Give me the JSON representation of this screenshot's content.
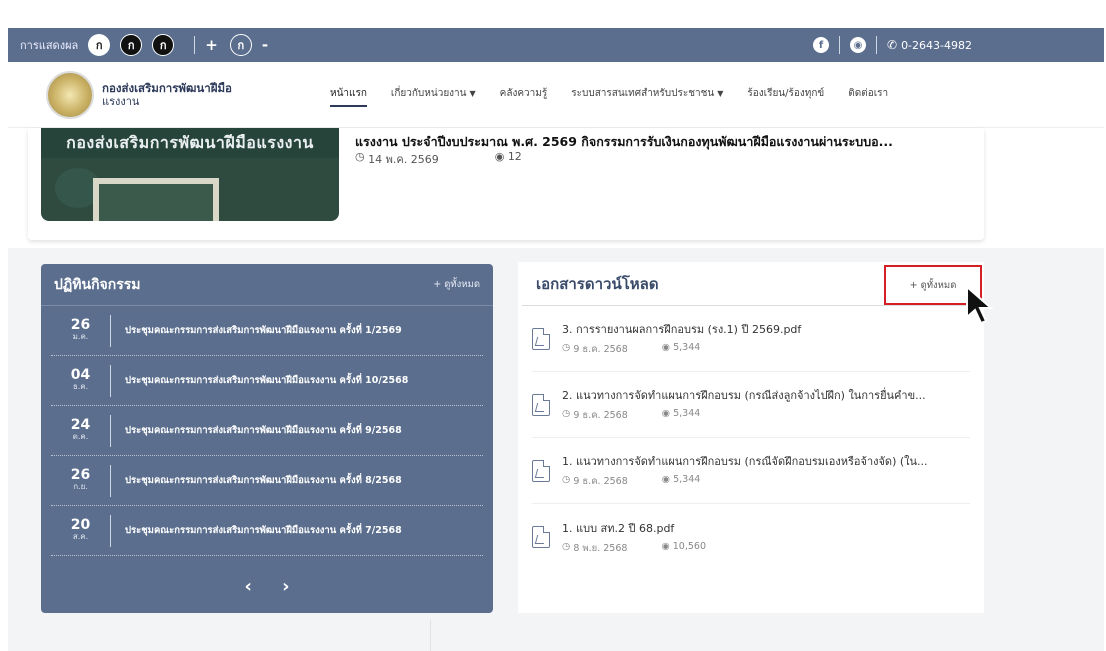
{
  "topbar": {
    "display_label": "การแสดงผล",
    "contrast_buttons": [
      "ก",
      "ก",
      "ก"
    ],
    "font_plus": "+",
    "font_reset": "ก",
    "font_minus": "-",
    "phone": "0-2643-4982"
  },
  "header": {
    "org_line1": "กองส่งเสริมการพัฒนาฝีมือ",
    "org_line2": "แรงงาน",
    "nav": [
      {
        "label": "หน้าแรก",
        "active": true
      },
      {
        "label": "เกี่ยวกับหน่วยงาน",
        "caret": true
      },
      {
        "label": "คลังความรู้"
      },
      {
        "label": "ระบบสารสนเทศสำหรับประชาชน",
        "caret": true
      },
      {
        "label": "ร้องเรียน/ร้องทุกข์"
      },
      {
        "label": "ติดต่อเรา"
      }
    ]
  },
  "news": {
    "image_text": "กองส่งเสริมการพัฒนาฝีมือแรงงาน",
    "title": "แรงงาน ประจำปีงบประมาณ พ.ศ. 2569 กิจกรรมการรับเงินกองทุนพัฒนาฝีมือแรงงานผ่านระบบอ...",
    "date": "14 พ.ค. 2569",
    "views": "12"
  },
  "activities": {
    "title": "ปฏิทินกิจกรรม",
    "see_all": "+ ดูทั้งหมด",
    "items": [
      {
        "day": "26",
        "month": "ม.ค.",
        "text": "ประชุมคณะกรรมการส่งเสริมการพัฒนาฝีมือแรงงาน ครั้งที่ 1/2569"
      },
      {
        "day": "04",
        "month": "ธ.ค.",
        "text": "ประชุมคณะกรรมการส่งเสริมการพัฒนาฝีมือแรงงาน ครั้งที่ 10/2568"
      },
      {
        "day": "24",
        "month": "ต.ค.",
        "text": "ประชุมคณะกรรมการส่งเสริมการพัฒนาฝีมือแรงงาน ครั้งที่ 9/2568"
      },
      {
        "day": "26",
        "month": "ก.ย.",
        "text": "ประชุมคณะกรรมการส่งเสริมการพัฒนาฝีมือแรงงาน ครั้งที่ 8/2568"
      },
      {
        "day": "20",
        "month": "ส.ค.",
        "text": "ประชุมคณะกรรมการส่งเสริมการพัฒนาฝีมือแรงงาน ครั้งที่ 7/2568"
      }
    ],
    "prev": "‹",
    "next": "›"
  },
  "downloads": {
    "title": "เอกสารดาวน์โหลด",
    "see_all": "+ ดูทั้งหมด",
    "files": [
      {
        "name": "3. การรายงานผลการฝึกอบรม (รง.1) ปี 2569.pdf",
        "date": "9 ธ.ค. 2568",
        "views": "5,344"
      },
      {
        "name": "2. แนวทางการจัดทำแผนการฝึกอบรม (กรณีส่งลูกจ้างไปฝึก) ในการยื่นคำข...",
        "date": "9 ธ.ค. 2568",
        "views": "5,344"
      },
      {
        "name": "1. แนวทางการจัดทำแผนการฝึกอบรม (กรณีจัดฝึกอบรมเองหรือจ้างจัด) (ใน...",
        "date": "9 ธ.ค. 2568",
        "views": "5,344"
      },
      {
        "name": "1. แบบ สท.2 ปี 68.pdf",
        "date": "8 พ.ย. 2568",
        "views": "10,560"
      }
    ]
  },
  "colors": {
    "bar": "#5b6e8e",
    "highlight": "#d41f26"
  }
}
